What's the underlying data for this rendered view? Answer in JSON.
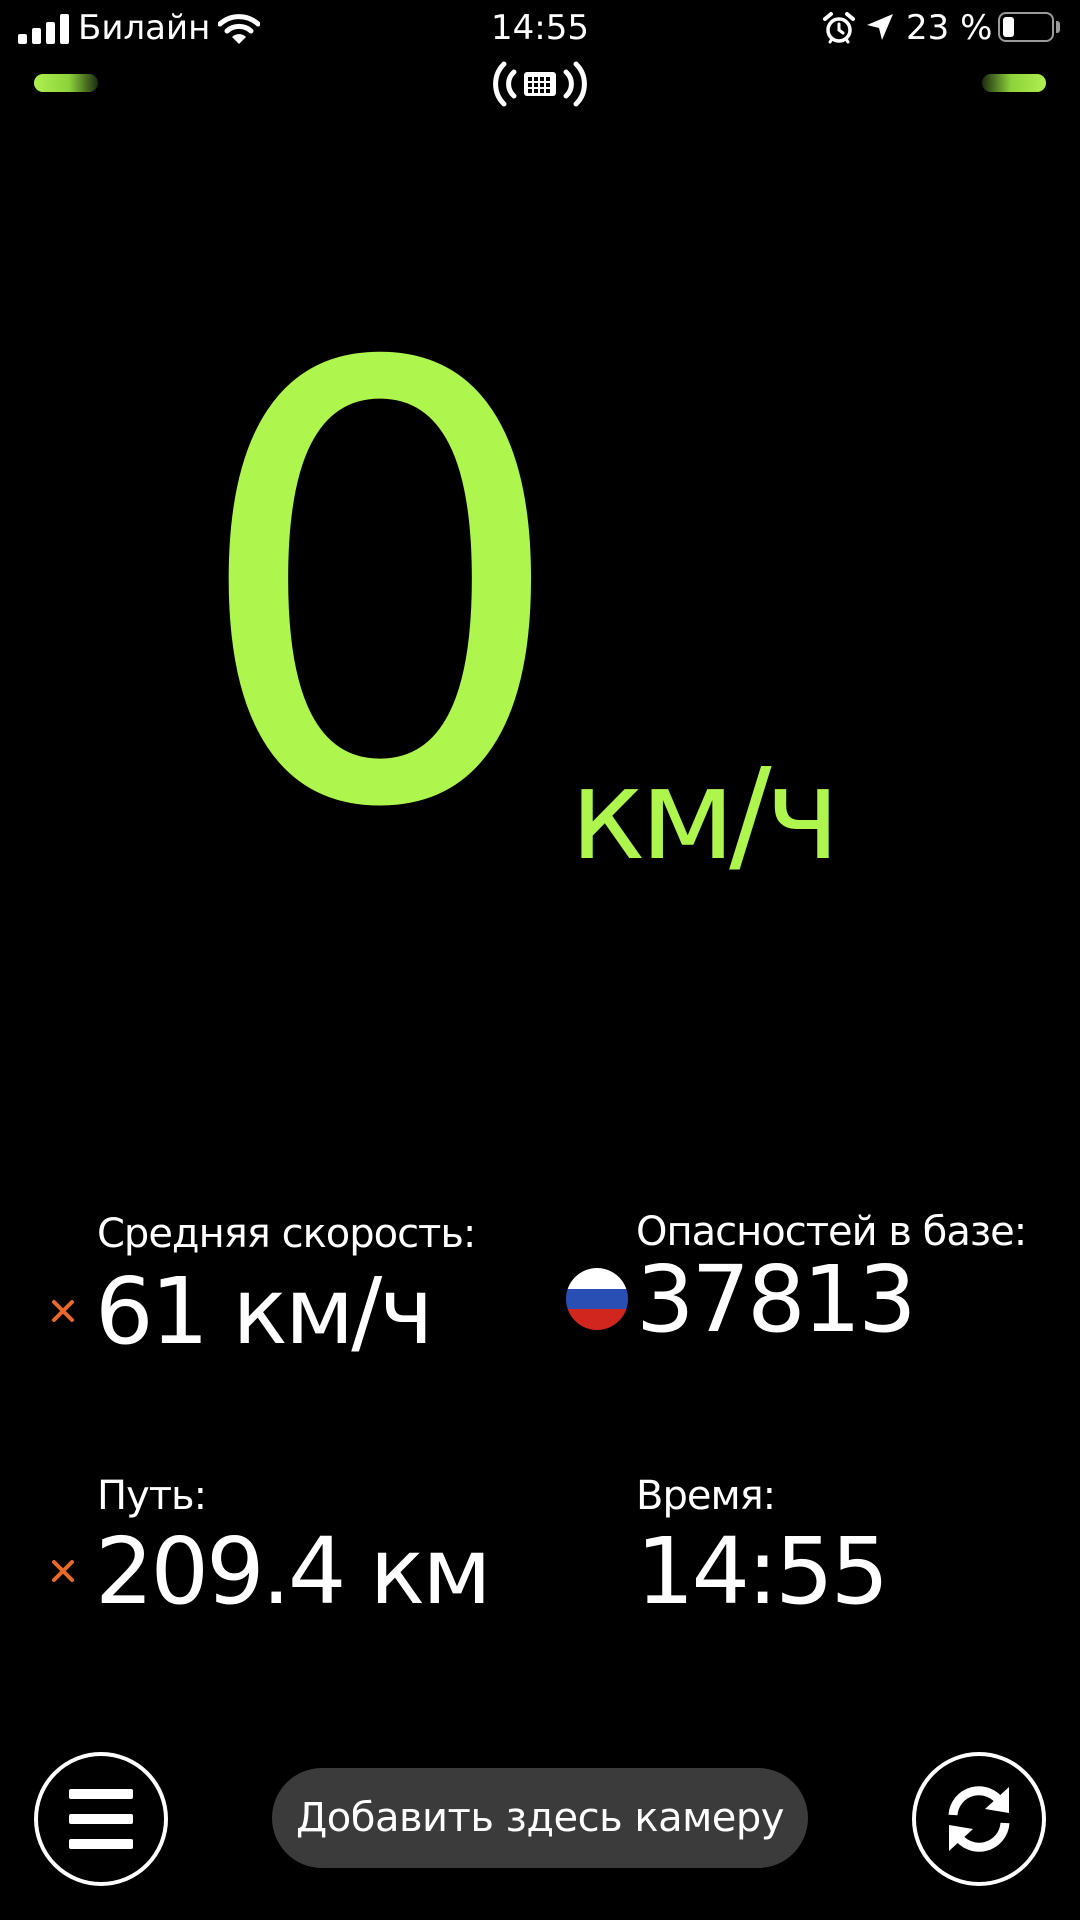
{
  "status_bar": {
    "carrier": "Билайн",
    "time": "14:55",
    "battery_percent": "23 %",
    "battery_level": 0.23,
    "icons": [
      "signal-icon",
      "wifi-icon",
      "alarm-icon",
      "location-arrow-icon",
      "battery-icon"
    ]
  },
  "gps": {
    "icon": "gps-signal-icon",
    "indicator_color": "#aef54e"
  },
  "speed": {
    "value": "0",
    "unit": "км/ч",
    "color": "#aef54e"
  },
  "stats": {
    "avg_speed": {
      "label": "Средняя скорость:",
      "value": "61 км/ч",
      "reset_icon": "close-icon"
    },
    "hazards": {
      "label": "Опасностей в базе:",
      "value": "37813",
      "flag_icon": "russia-flag-icon"
    },
    "distance": {
      "label": "Путь:",
      "value": "209.4 км",
      "reset_icon": "close-icon"
    },
    "time": {
      "label": "Время:",
      "value": "14:55"
    }
  },
  "bottom_bar": {
    "menu_icon": "hamburger-menu-icon",
    "add_camera_label": "Добавить здесь камеру",
    "refresh_icon": "refresh-icon"
  },
  "colors": {
    "accent": "#aef54e",
    "reset_x": "#e8692a",
    "button_bg": "#3b3b3b",
    "background": "#000000"
  }
}
